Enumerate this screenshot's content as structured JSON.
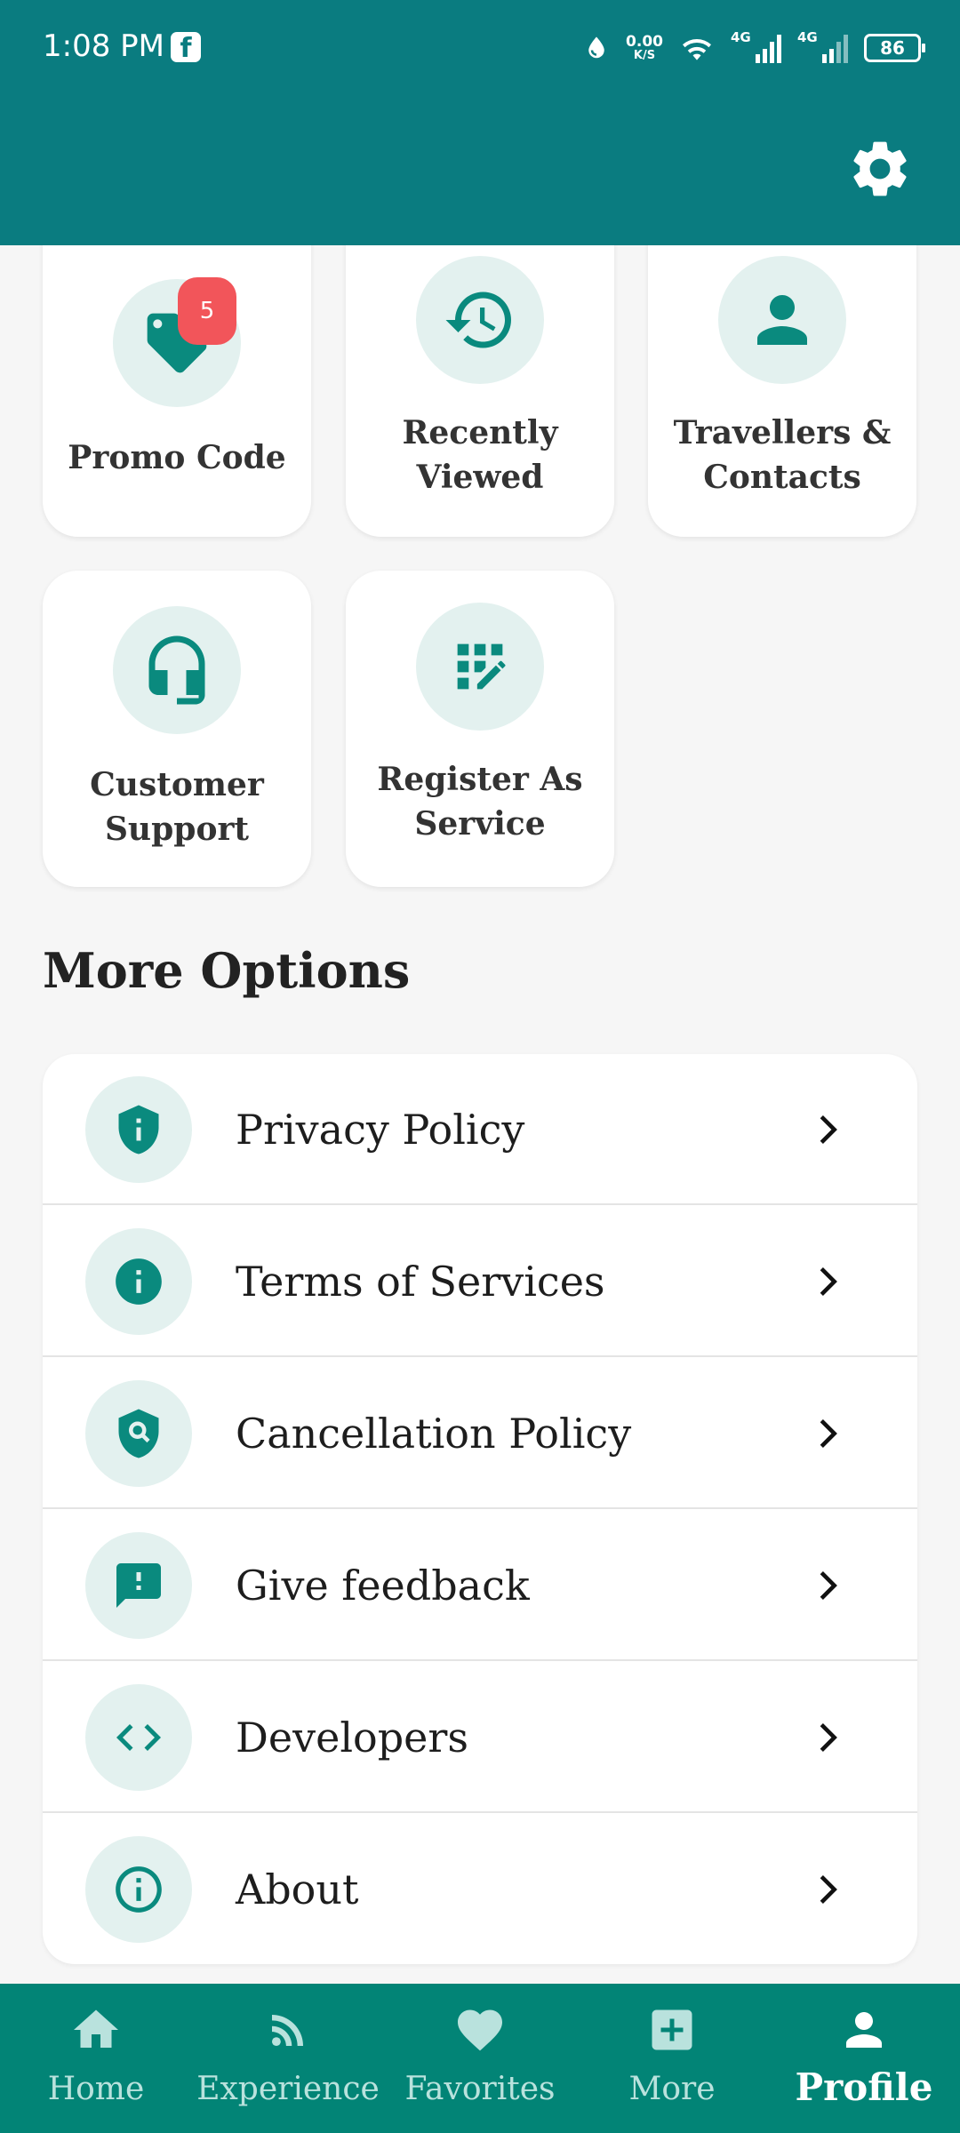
{
  "status_bar": {
    "time": "1:08 PM",
    "fb_icon": "f",
    "net_speed_value": "0.00",
    "net_speed_unit": "K/S",
    "signal1_label": "4G",
    "signal2_label": "4G",
    "battery": "86"
  },
  "header": {
    "settings_icon": "gear-icon"
  },
  "cards": [
    {
      "label_line1": "Promo Code",
      "label_line2": "",
      "badge": "5",
      "icon": "tag-icon"
    },
    {
      "label_line1": "Recently",
      "label_line2": "Viewed",
      "icon": "history-icon"
    },
    {
      "label_line1": "Travellers &",
      "label_line2": "Contacts",
      "icon": "person-icon"
    },
    {
      "label_line1": "Customer",
      "label_line2": "Support",
      "icon": "headset-icon"
    },
    {
      "label_line1": "Register As",
      "label_line2": "Service",
      "icon": "app-registration-icon"
    }
  ],
  "more_options": {
    "title": "More Options",
    "items": [
      {
        "label": "Privacy Policy",
        "icon": "shield-info-icon"
      },
      {
        "label": "Terms of Services",
        "icon": "info-filled-icon"
      },
      {
        "label": "Cancellation Policy",
        "icon": "shield-search-icon"
      },
      {
        "label": "Give feedback",
        "icon": "feedback-icon"
      },
      {
        "label": "Developers",
        "icon": "code-icon"
      },
      {
        "label": "About",
        "icon": "info-outline-icon"
      }
    ]
  },
  "bottom_nav": {
    "items": [
      {
        "label": "Home",
        "icon": "home-icon"
      },
      {
        "label": "Experience",
        "icon": "rss-icon"
      },
      {
        "label": "Favorites",
        "icon": "heart-icon"
      },
      {
        "label": "More",
        "icon": "plus-box-icon"
      },
      {
        "label": "Profile",
        "icon": "person-icon",
        "active": true
      }
    ]
  },
  "colors": {
    "header": "#0a7c80",
    "accent": "#028476",
    "icon_bg": "#e3f1ef",
    "badge": "#f2555a"
  }
}
